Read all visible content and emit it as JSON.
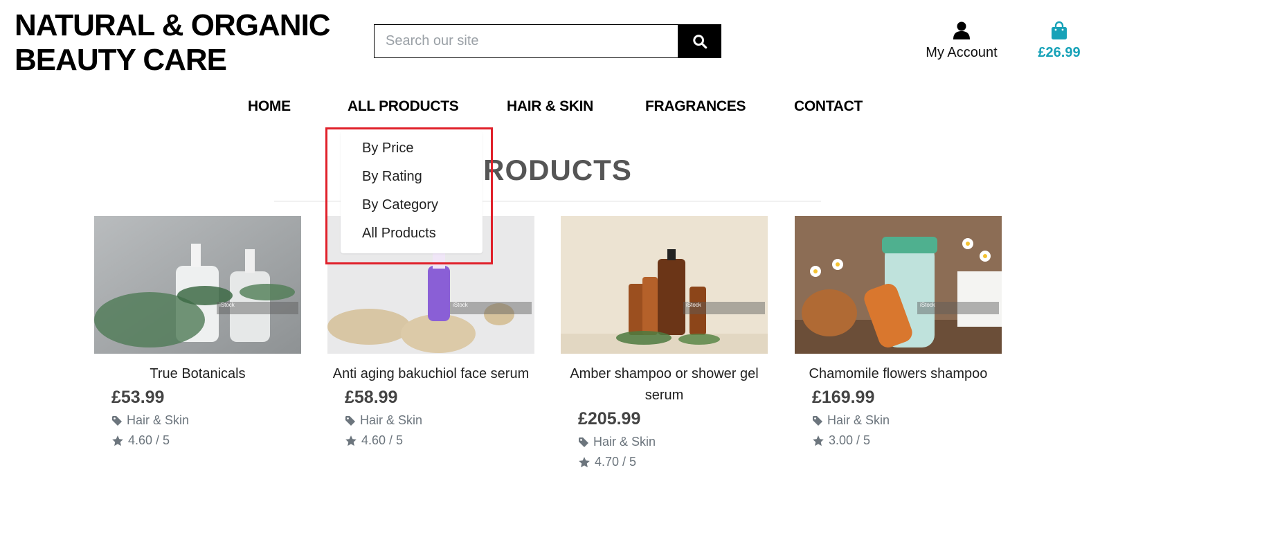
{
  "brand": {
    "line1": "NATURAL & ORGANIC",
    "line2": "BEAUTY CARE"
  },
  "search": {
    "placeholder": "Search our site",
    "icon": "search-icon"
  },
  "account": {
    "label": "My Account",
    "icon": "user-icon"
  },
  "bag": {
    "total": "£26.99",
    "icon": "shopping-bag-icon",
    "color": "#17a2b8"
  },
  "nav": [
    {
      "label": "HOME"
    },
    {
      "label": "ALL PRODUCTS"
    },
    {
      "label": "HAIR & SKIN"
    },
    {
      "label": "FRAGRANCES"
    },
    {
      "label": "CONTACT"
    }
  ],
  "dropdown": {
    "items": [
      {
        "label": "By Price"
      },
      {
        "label": "By Rating"
      },
      {
        "label": "By Category"
      },
      {
        "label": "All Products"
      }
    ],
    "highlight_color": "#e0202a"
  },
  "page_title": "PRODUCTS",
  "products": [
    {
      "name": "True Botanicals",
      "price": "£53.99",
      "category": "Hair & Skin",
      "rating": "4.60 / 5",
      "watermark": "iStock"
    },
    {
      "name": "Anti aging bakuchiol face serum",
      "price": "£58.99",
      "category": "Hair & Skin",
      "rating": "4.60 / 5",
      "watermark": "iStock"
    },
    {
      "name": "Amber shampoo or shower gel serum",
      "price": "£205.99",
      "category": "Hair & Skin",
      "rating": "4.70 / 5",
      "watermark": "iStock"
    },
    {
      "name": "Chamomile flowers shampoo",
      "price": "£169.99",
      "category": "Hair & Skin",
      "rating": "3.00 / 5",
      "watermark": "iStock"
    }
  ]
}
